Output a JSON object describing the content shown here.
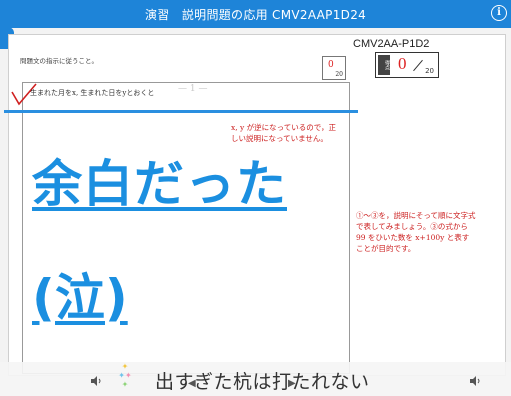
{
  "header": {
    "title": "演習　説明問題の応用 CMV2AAP1D24",
    "info_label": "i"
  },
  "worksheet": {
    "code": "CMV2AA-P1D2",
    "instruction": "問題文の指示に従うこと。",
    "question_text": "生まれた月をx, 生まれた日をyとおくと",
    "faint_text": "— 1 —",
    "small_score": {
      "value": "0",
      "max": "20"
    },
    "main_score": {
      "label": "得点",
      "value": "0",
      "max": "20"
    },
    "comment_1": "x, y が逆になっているので，正しい説明になっていません。",
    "comment_2": "①～③を，説明にそって順に文字式で表してみましょう。③の式から 99 をひいた数を x+100y と表すことが目的です。"
  },
  "overlay": {
    "line_1": "余白だった",
    "line_2": "(泣)"
  },
  "player": {
    "subtitle": "出すぎた杭は打たれない",
    "left_speaker_icon": "speaker-icon",
    "right_speaker_icon": "speaker-icon"
  },
  "colors": {
    "accent": "#1e84d8",
    "overlay_text": "#1b8fe0",
    "correction": "#cc1f1f"
  }
}
